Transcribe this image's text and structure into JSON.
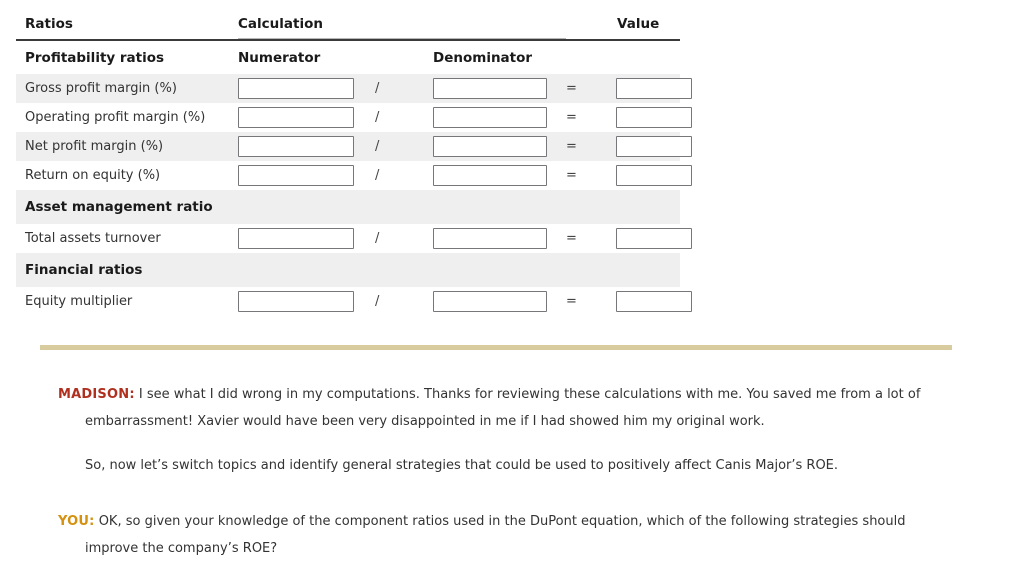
{
  "table": {
    "headers": {
      "ratios": "Ratios",
      "calculation": "Calculation",
      "value": "Value"
    },
    "subheaders": {
      "section_title": "Profitability ratios",
      "numerator": "Numerator",
      "denominator": "Denominator"
    },
    "operators": {
      "divide": "/",
      "equals": "="
    },
    "sections": [
      {
        "title": "Profitability ratios",
        "rows": [
          {
            "label": "Gross profit margin (%)",
            "numerator": "",
            "denominator": "",
            "value": ""
          },
          {
            "label": "Operating profit margin (%)",
            "numerator": "",
            "denominator": "",
            "value": ""
          },
          {
            "label": "Net profit margin (%)",
            "numerator": "",
            "denominator": "",
            "value": ""
          },
          {
            "label": "Return on equity (%)",
            "numerator": "",
            "denominator": "",
            "value": ""
          }
        ]
      },
      {
        "title": "Asset management ratio",
        "rows": [
          {
            "label": "Total assets turnover",
            "numerator": "",
            "denominator": "",
            "value": ""
          }
        ]
      },
      {
        "title": "Financial ratios",
        "rows": [
          {
            "label": "Equity multiplier",
            "numerator": "",
            "denominator": "",
            "value": ""
          }
        ]
      }
    ],
    "rows_flat": [
      {
        "label": "Gross profit margin (%)"
      },
      {
        "label": "Operating profit margin (%)"
      },
      {
        "label": "Net profit margin (%)"
      },
      {
        "label": "Return on equity (%)"
      },
      {
        "label": "Total assets turnover"
      },
      {
        "label": "Equity multiplier"
      }
    ],
    "section_titles": {
      "asset_management": "Asset management ratio",
      "financial": "Financial ratios"
    }
  },
  "dialogue": {
    "madison": {
      "speaker": "MADISON:",
      "line1": "I see what I did wrong in my computations. Thanks for reviewing these calculations with me. You saved me from a lot of embarrassment! Xavier would have been very disappointed in me if I had showed him my original work.",
      "line2": "So, now let’s switch topics and identify general strategies that could be used to positively affect Canis Major’s ROE."
    },
    "you": {
      "speaker": "YOU:",
      "line1": "OK, so given your knowledge of the component ratios used in the DuPont equation, which of the following strategies should improve the company’s ROE?"
    }
  },
  "colors": {
    "madison_label": "#b0301f",
    "you_label": "#d4900f",
    "divider": "#d8cb9e",
    "row_stripe": "#efefef",
    "header_rule": "#3a3a3a"
  }
}
